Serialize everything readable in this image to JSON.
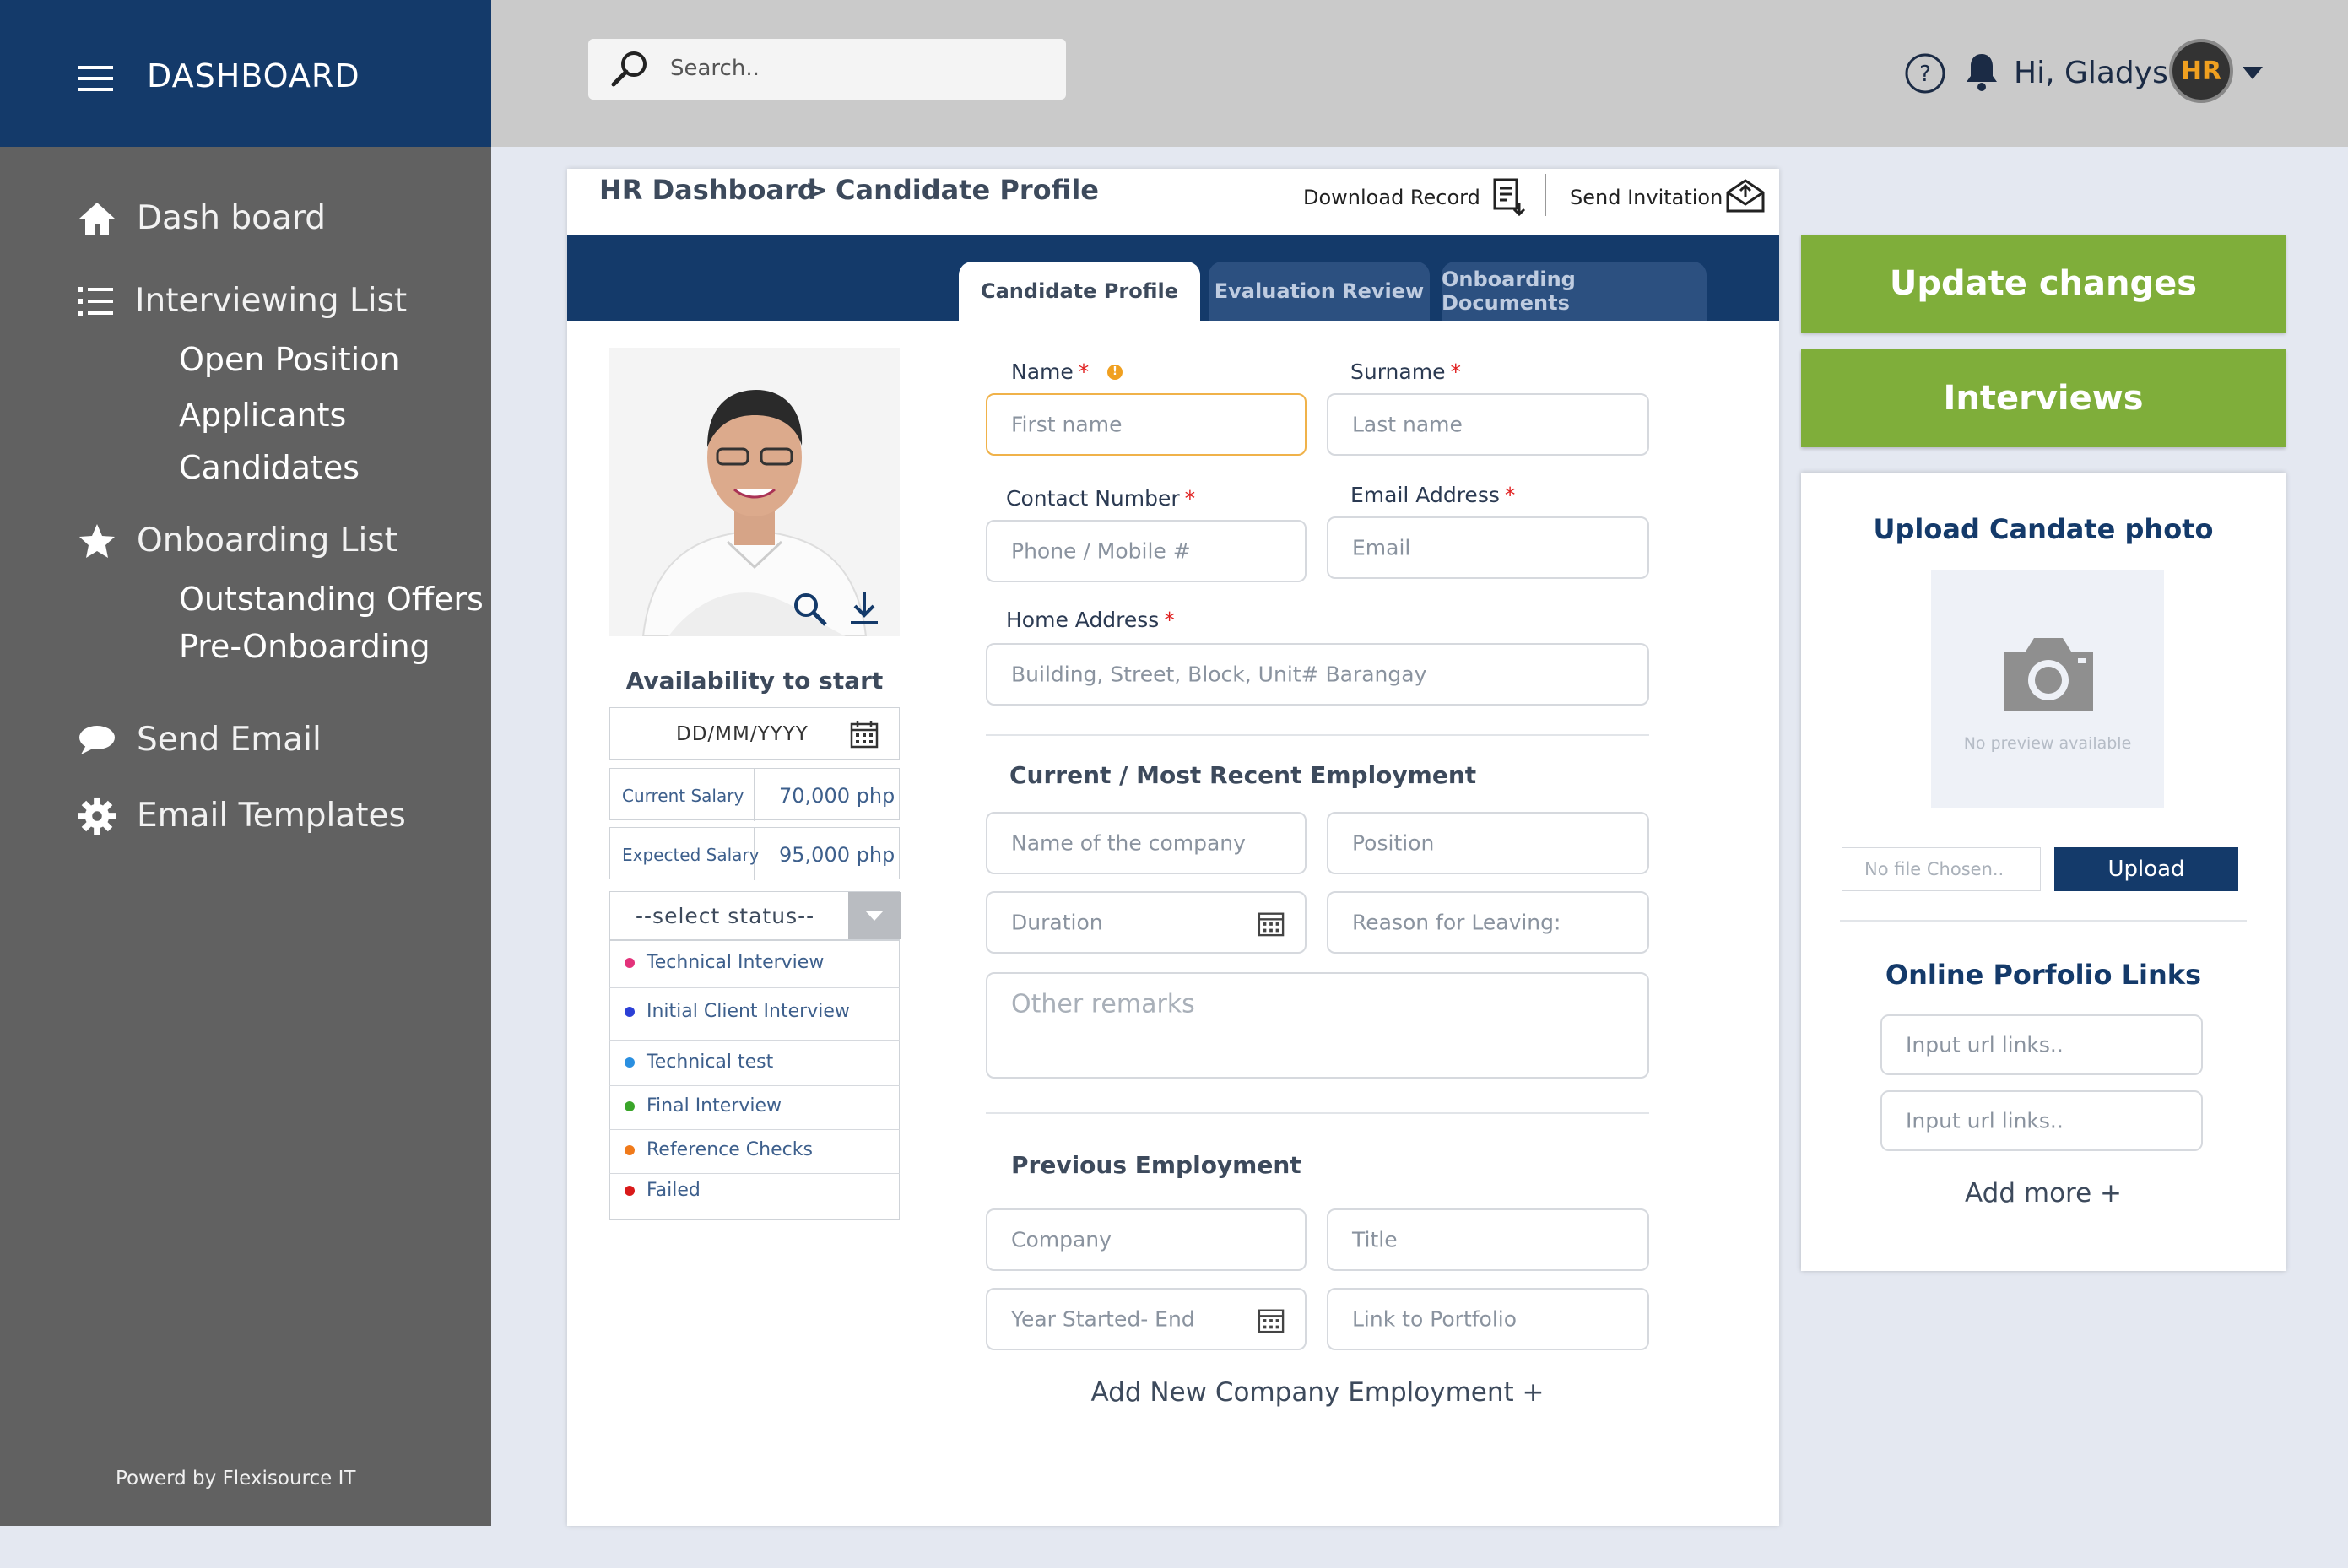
{
  "sidebar": {
    "title": "DASHBOARD",
    "items": [
      {
        "label": "Dash board",
        "icon": "home-icon"
      },
      {
        "label": "Interviewing List",
        "icon": "list-icon"
      },
      {
        "label": "Onboarding List",
        "icon": "star-icon"
      },
      {
        "label": "Send Email",
        "icon": "chat-bubble-icon"
      },
      {
        "label": "Email Templates",
        "icon": "gear-icon"
      }
    ],
    "interviewing_sub": [
      "Open Position",
      "Applicants",
      "Candidates"
    ],
    "onboarding_sub": [
      "Outstanding Offers",
      "Pre-Onboarding"
    ],
    "footer": "Powerd by Flexisource IT"
  },
  "header": {
    "search_placeholder": "Search..",
    "greeting": "Hi, Gladys !",
    "avatar_text": "HR"
  },
  "breadcrumb": {
    "root": "HR Dashboard",
    "sep": ">",
    "current": "Candidate Profile"
  },
  "actions": {
    "download": "Download Record",
    "invite": "Send Invitation"
  },
  "tabs": [
    "Candidate Profile",
    "Evaluation Review",
    "Onboarding Documents"
  ],
  "left": {
    "availability_title": "Availability to start",
    "date_placeholder": "DD/MM/YYYY",
    "current_salary_label": "Current Salary",
    "current_salary_value": "70,000 php",
    "expected_salary_label": "Expected Salary",
    "expected_salary_value": "95,000 php",
    "status_select": "--select status--",
    "statuses": [
      {
        "label": "Technical Interview",
        "color": "#e3327a"
      },
      {
        "label": "Initial Client Interview",
        "color": "#2b3fd6"
      },
      {
        "label": "Technical test",
        "color": "#2a8fe0"
      },
      {
        "label": "Final Interview",
        "color": "#3aa52a"
      },
      {
        "label": "Reference Checks",
        "color": "#f07a1a"
      },
      {
        "label": "Failed",
        "color": "#d91a1a"
      }
    ]
  },
  "form": {
    "name_label": "Name",
    "surname_label": "Surname",
    "first_name_ph": "First name",
    "last_name_ph": "Last name",
    "contact_label": "Contact Number",
    "email_label": "Email Address",
    "phone_ph": "Phone / Mobile #",
    "email_ph": "Email",
    "address_label": "Home Address",
    "address_ph": "Building, Street, Block, Unit# Barangay",
    "current_title": "Current / Most Recent Employment",
    "company_ph": "Name of the company",
    "position_ph": "Position",
    "duration_ph": "Duration",
    "reason_ph": "Reason for Leaving:",
    "remarks_ph": "Other remarks",
    "previous_title": "Previous Employment",
    "prev_company_ph": "Company",
    "prev_title_ph": "Title",
    "prev_year_ph": "Year Started- End",
    "prev_link_ph": "Link to Portfolio",
    "add_company": "Add New Company Employment +"
  },
  "right": {
    "update_btn": "Update changes",
    "interviews_btn": "Interviews",
    "upload_title": "Upload Candate photo",
    "no_preview": "No preview available",
    "file_ph": "No file Chosen..",
    "upload_btn": "Upload",
    "portfolio_title": "Online Porfolio Links",
    "url_ph_1": "Input url links..",
    "url_ph_2": "Input url links..",
    "add_more": "Add more +"
  },
  "colors": {
    "navy": "#143a6a",
    "green": "#7fae3a",
    "sidebar": "#616161",
    "focus": "#f0b24a"
  }
}
